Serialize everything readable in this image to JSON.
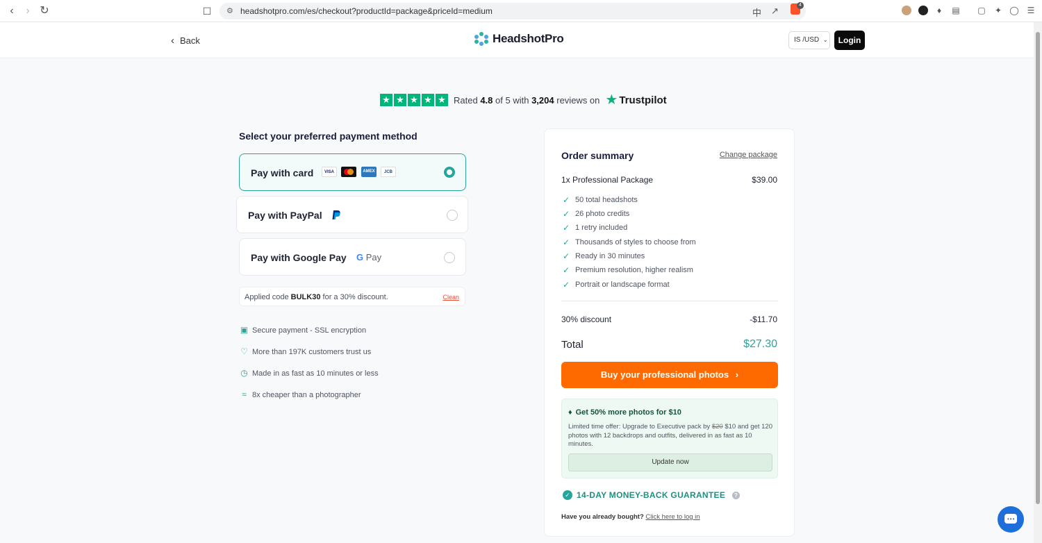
{
  "browser": {
    "url": "headshotpro.com/es/checkout?productId=package&priceId=medium",
    "brave_badge": "4"
  },
  "header": {
    "back_label": "Back",
    "logo_text": "HeadshotPro",
    "currency": "IS /USD",
    "login_label": "Login"
  },
  "trust": {
    "rated_prefix": "Rated",
    "rating": "4.8",
    "of_text": "of 5 with",
    "reviews": "3,204",
    "reviews_suffix": "reviews on",
    "brand": "Trustpilot"
  },
  "payment": {
    "title": "Select your preferred payment method",
    "options": [
      {
        "label": "Pay with card",
        "selected": true
      },
      {
        "label": "Pay with PayPal",
        "selected": false
      },
      {
        "label": "Pay with Google Pay",
        "selected": false
      }
    ],
    "card_logos": [
      "VISA",
      "MC",
      "AMEX",
      "JCB"
    ],
    "gpay_label": "Pay"
  },
  "coupon": {
    "prefix": "Applied code",
    "code": "BULK30",
    "suffix": "for a 30% discount.",
    "clean_label": "Clean"
  },
  "features": [
    {
      "icon": "lock-icon",
      "text": "Secure payment - SSL encryption"
    },
    {
      "icon": "heart-icon",
      "text": "More than 197K customers trust us"
    },
    {
      "icon": "clock-icon",
      "text": "Made in as fast as 10 minutes or less"
    },
    {
      "icon": "money-icon",
      "text": "8x cheaper than a photographer"
    }
  ],
  "order": {
    "title": "Order summary",
    "change_label": "Change package",
    "package_name": "1x Professional Package",
    "package_price": "$39.00",
    "includes": [
      "50 total headshots",
      "26 photo credits",
      "1 retry included",
      "Thousands of styles to choose from",
      "Ready in 30 minutes",
      "Premium resolution, higher realism",
      "Portrait or landscape format"
    ],
    "discount_label": "30% discount",
    "discount_value": "-$11.70",
    "total_label": "Total",
    "total_value": "$27.30",
    "buy_label": "Buy your professional photos"
  },
  "upsell": {
    "title": "Get 50% more photos for $10",
    "desc_prefix": "Limited time offer: Upgrade to Executive pack by",
    "old_price": "$20",
    "desc_suffix": "$10 and get 120 photos with 12 backdrops and outfits, delivered in as fast as 10 minutes.",
    "button": "Update now"
  },
  "guarantee": {
    "text": "14-DAY MONEY-BACK GUARANTEE",
    "bought_prefix": "Have you already bought?",
    "login_link": "Click here to log in"
  },
  "colors": {
    "accent": "#26a69a",
    "cta": "#ff6a00",
    "trustpilot": "#00b67a"
  }
}
